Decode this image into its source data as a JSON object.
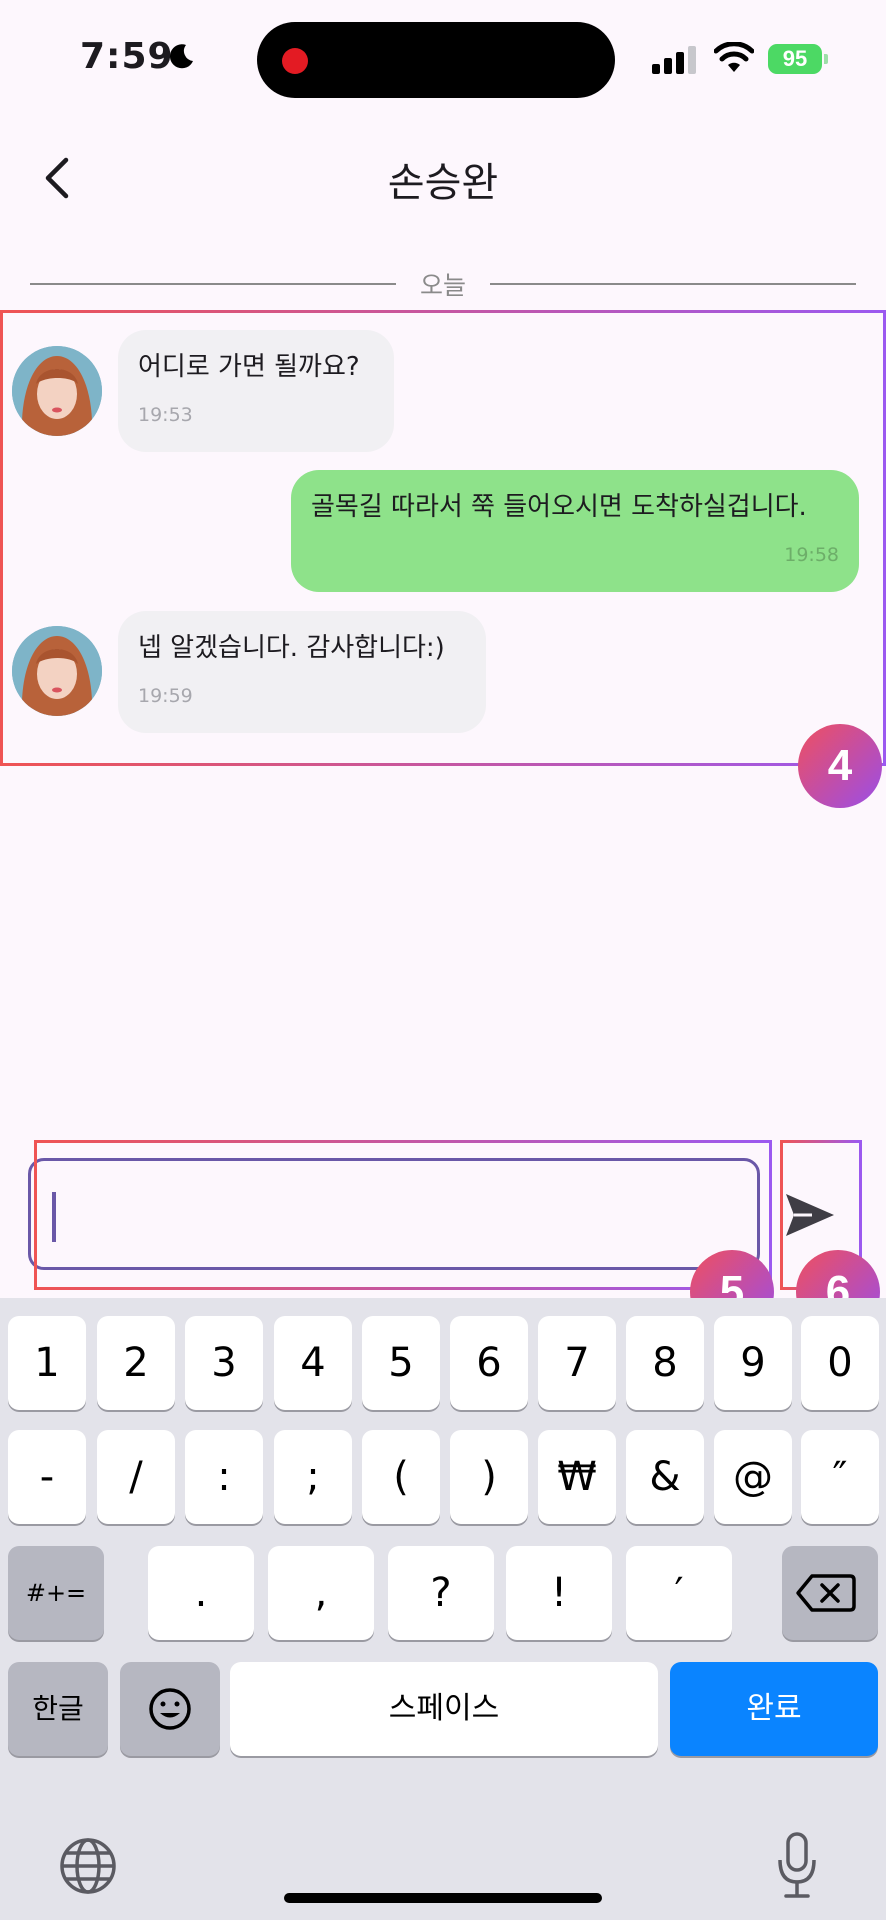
{
  "status_bar": {
    "time": "7:59",
    "battery": "95"
  },
  "header": {
    "title": "손승완"
  },
  "date_divider": {
    "label": "오늘"
  },
  "messages": [
    {
      "direction": "received",
      "text": "어디로 가면 될까요?",
      "time": "19:53"
    },
    {
      "direction": "sent",
      "text": "골목길 따라서 쭉 들어오시면 도착하실겁니다.",
      "time": "19:58"
    },
    {
      "direction": "received",
      "text": "넵 알겠습니다. 감사합니다:)",
      "time": "19:59"
    }
  ],
  "input": {
    "value": ""
  },
  "annotations": {
    "messages_area": "4",
    "input_field": "5",
    "send_button": "6"
  },
  "keyboard": {
    "row1": [
      "1",
      "2",
      "3",
      "4",
      "5",
      "6",
      "7",
      "8",
      "9",
      "0"
    ],
    "row2": [
      "-",
      "/",
      ":",
      ";",
      "(",
      ")",
      "₩",
      "&",
      "@",
      "″"
    ],
    "row3": {
      "symbols": "#+=",
      "keys": [
        ".",
        ",",
        "?",
        "!",
        "′"
      ]
    },
    "row4": {
      "lang": "한글",
      "space": "스페이스",
      "done": "완료"
    }
  },
  "colors": {
    "sent_bubble": "#8ee28a",
    "received_bubble": "#f1f0f3",
    "accent": "#6a58a8",
    "done_key": "#0a84ff",
    "annotation_start": "#ef5454",
    "annotation_end": "#9b59f0"
  },
  "icons": [
    "moon-icon",
    "signal-icon",
    "wifi-icon",
    "battery-icon",
    "back-icon",
    "send-icon",
    "backspace-icon",
    "emoji-icon",
    "globe-icon",
    "mic-icon"
  ]
}
